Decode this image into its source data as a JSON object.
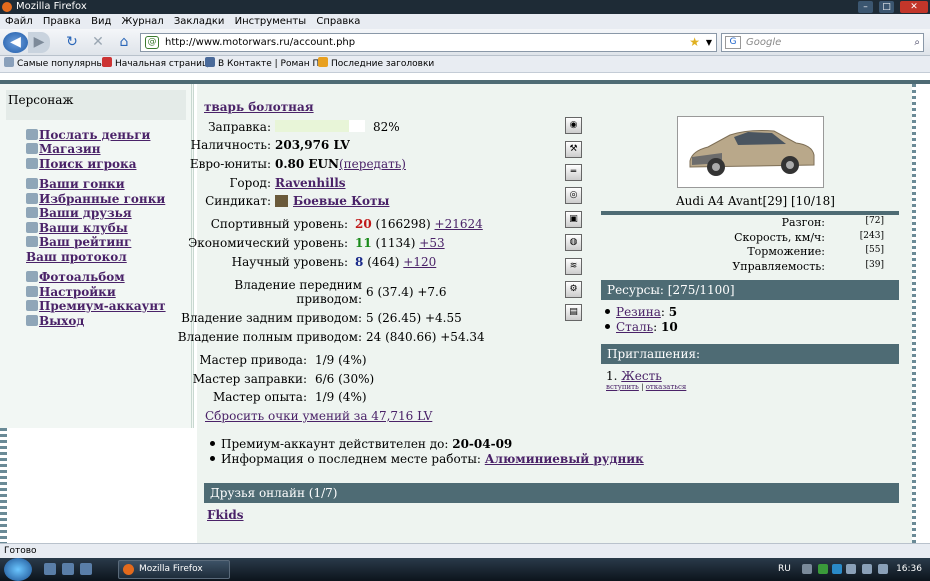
{
  "window": {
    "title": "Mozilla Firefox"
  },
  "menu": [
    "Файл",
    "Правка",
    "Вид",
    "Журнал",
    "Закладки",
    "Инструменты",
    "Справка"
  ],
  "nav": {
    "url": "http://www.motorwars.ru/account.php",
    "search_placeholder": "Google"
  },
  "bookmarks": [
    "Самые популярные",
    "Начальная страница",
    "В Контакте | Роман П...",
    "Последние заголовки"
  ],
  "status": "Готово",
  "taskbar": {
    "app": "Mozilla Firefox",
    "lang": "RU",
    "time": "16:36"
  },
  "sidebar": {
    "title": "Персонаж",
    "items": [
      "Послать деньги",
      "Магазин",
      "Поиск игрока",
      "Ваши гонки",
      "Избранные гонки",
      "Ваши друзья",
      "Ваши клубы",
      "Ваш рейтинг",
      "Ваш протокол",
      "Фотоальбом",
      "Настройки",
      "Премиум-аккаунт",
      "Выход"
    ]
  },
  "profile": {
    "name": "тварь болотная",
    "fuel": {
      "label": "Заправка:",
      "value": "82%",
      "level": 0.82
    },
    "cash": {
      "label": "Наличность:",
      "value": "203,976 LV"
    },
    "euro": {
      "label": "Евро-юниты:",
      "value": "0.80 EUN",
      "link": "(передать)"
    },
    "city": {
      "label": "Город:",
      "value": "Ravenhills"
    },
    "syndicate": {
      "label": "Синдикат:",
      "value": "Боевые Коты"
    },
    "sport": {
      "label": "Спортивный уровень:",
      "level": "20",
      "xp": "(166298)",
      "delta": "+21624"
    },
    "econ": {
      "label": "Экономический уровень:",
      "level": "11",
      "xp": "(1134)",
      "delta": "+53"
    },
    "sci": {
      "label": "Научный уровень:",
      "level": "8",
      "xp": "(464)",
      "delta": "+120"
    },
    "fwd": {
      "label1": "Владение передним",
      "label2": "приводом:",
      "value": "6 (37.4) +7.6"
    },
    "rwd": {
      "label": "Владение задним приводом:",
      "value": "5 (26.45) +4.55"
    },
    "awd": {
      "label": "Владение полным приводом:",
      "value": "24 (840.66) +54.34"
    },
    "drive_master": {
      "label": "Мастер привода:",
      "value": "1/9 (4%)"
    },
    "fuel_master": {
      "label": "Мастер заправки:",
      "value": "6/6 (30%)"
    },
    "exp_master": {
      "label": "Мастер опыта:",
      "value": "1/9 (4%)"
    },
    "reset": "Сбросить очки умений за 47,716 LV",
    "premium_label": "Премиум-аккаунт действителен до:",
    "premium_date": "20-04-09",
    "work_label": "Информация о последнем месте работы:",
    "work_value": "Алюминиевый рудник"
  },
  "friends": {
    "title": "Друзья онлайн (1/7)",
    "items": [
      "Fkids"
    ]
  },
  "car": {
    "name": "Audi A4 Avant[29] [10/18]",
    "stats": [
      {
        "label": "Разгон:",
        "value": "[72]"
      },
      {
        "label": "Скорость, км/ч:",
        "value": "[243]"
      },
      {
        "label": "Торможение:",
        "value": "[55]"
      },
      {
        "label": "Управляемость:",
        "value": "[39]"
      }
    ]
  },
  "resources": {
    "title": "Ресурсы: [275/1100]",
    "items": [
      {
        "name": "Резина",
        "sep": ":",
        "value": "5"
      },
      {
        "name": "Сталь",
        "sep": ":",
        "value": "10"
      }
    ]
  },
  "invites": {
    "title": "Приглашения:",
    "num": "1.",
    "name": "Жесть",
    "accept": "вступить",
    "decline": "отказаться",
    "sep": "|"
  },
  "colors": {
    "header": "#4e6b74",
    "panel": "#eef4f0",
    "link": "#4a2268"
  }
}
